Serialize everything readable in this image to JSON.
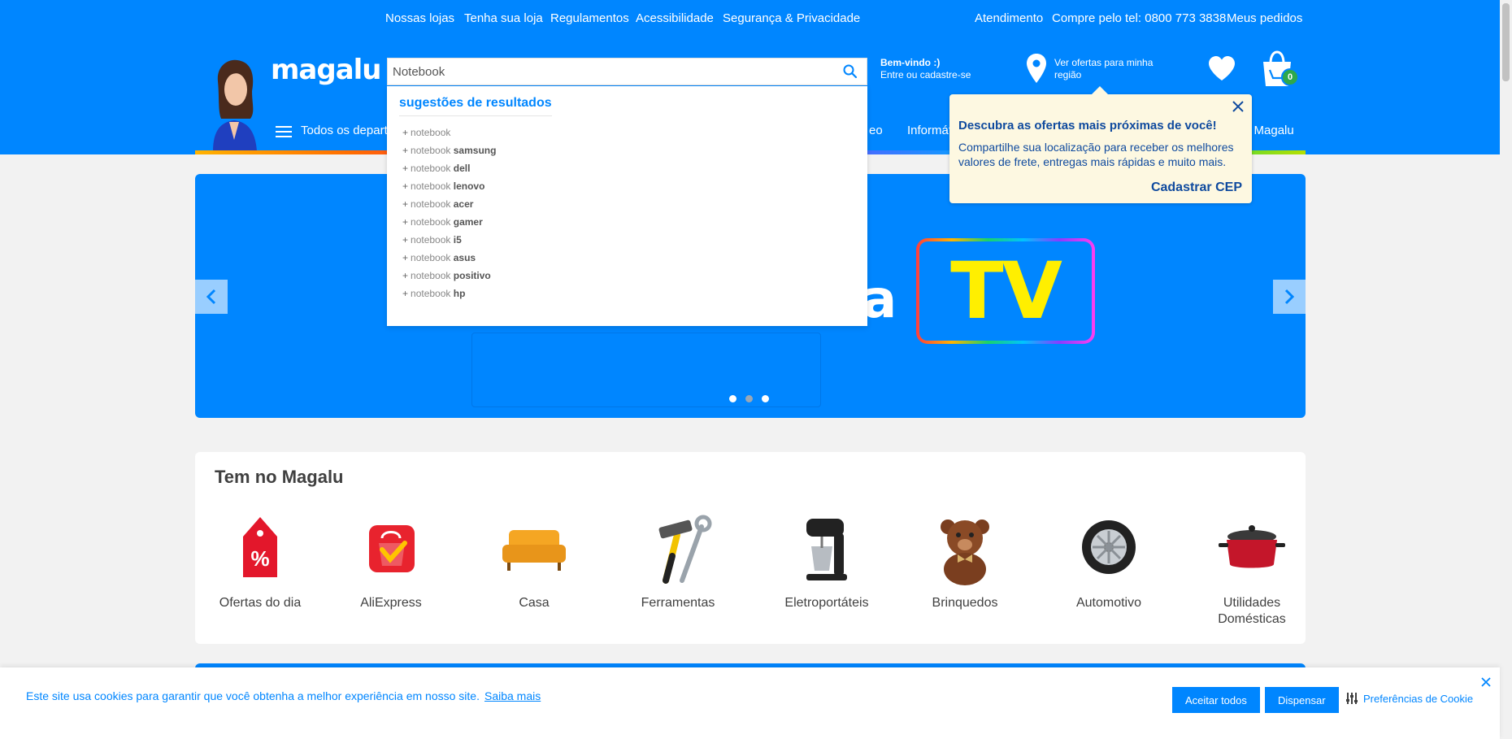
{
  "topbar": {
    "links": [
      "Nossas lojas",
      "Tenha sua loja",
      "Regulamentos",
      "Acessibilidade",
      "Segurança & Privacidade"
    ],
    "right": [
      "Atendimento",
      "Compre pelo tel: 0800 773 3838",
      "Meus pedidos"
    ]
  },
  "header": {
    "logo": "magalu",
    "search_value": "Notebook",
    "welcome_line1": "Bem-vindo :)",
    "welcome_line2": "Entre ou cadastre-se",
    "region": "Ver ofertas para minha região",
    "cart_count": "0"
  },
  "nav": {
    "departments": "Todos os departa",
    "partial1": "eo",
    "partial2": "Informát",
    "partial3": "o Magalu"
  },
  "suggestions": {
    "title": "sugestões de resultados",
    "items": [
      {
        "base": "notebook",
        "bold": ""
      },
      {
        "base": "notebook",
        "bold": "samsung"
      },
      {
        "base": "notebook",
        "bold": "dell"
      },
      {
        "base": "notebook",
        "bold": "lenovo"
      },
      {
        "base": "notebook",
        "bold": "acer"
      },
      {
        "base": "notebook",
        "bold": "gamer"
      },
      {
        "base": "notebook",
        "bold": "i5"
      },
      {
        "base": "notebook",
        "bold": "asus"
      },
      {
        "base": "notebook",
        "bold": "positivo"
      },
      {
        "base": "notebook",
        "bold": "hp"
      }
    ]
  },
  "popover": {
    "title": "Descubra as ofertas mais próximas de você!",
    "text": "Compartilhe sua localização para receber os melhores valores de frete, entregas mais rápidas e muito mais.",
    "cta": "Cadastrar CEP"
  },
  "banner": {
    "text_partial": "a",
    "tv": "TV",
    "slides": 3,
    "active_slide": 2
  },
  "categories": {
    "title": "Tem no Magalu",
    "items": [
      {
        "label": "Ofertas do dia",
        "icon": "offer-tag-icon"
      },
      {
        "label": "AliExpress",
        "icon": "aliexpress-icon"
      },
      {
        "label": "Casa",
        "icon": "sofa-icon"
      },
      {
        "label": "Ferramentas",
        "icon": "tools-icon"
      },
      {
        "label": "Eletroportáteis",
        "icon": "mixer-icon"
      },
      {
        "label": "Brinquedos",
        "icon": "teddy-bear-icon"
      },
      {
        "label": "Automotivo",
        "icon": "tire-icon"
      },
      {
        "label": "Utilidades Domésticas",
        "icon": "pot-icon"
      }
    ]
  },
  "cookie": {
    "text": "Este site usa cookies para garantir que você obtenha a melhor experiência em nosso site.",
    "link": "Saiba mais",
    "accept": "Aceitar todos",
    "dismiss": "Dispensar",
    "prefs": "Preferências de Cookie"
  },
  "colors": {
    "primary": "#0086ff",
    "popover_bg": "#fdf8e1",
    "popover_text": "#0f4a9e",
    "tv_yellow": "#ffef00",
    "badge_green": "#2ea84c"
  }
}
